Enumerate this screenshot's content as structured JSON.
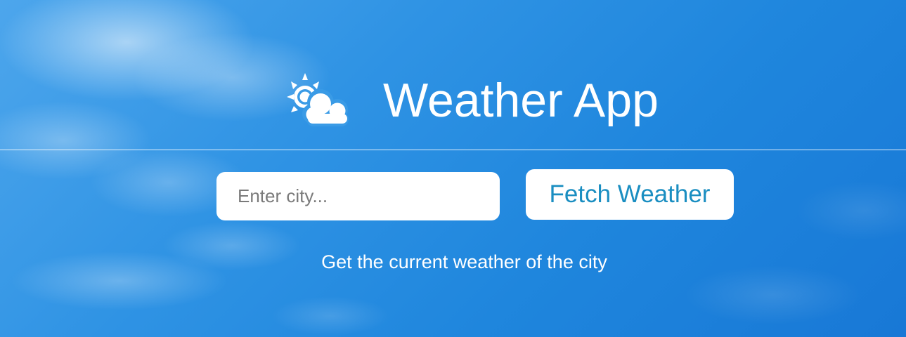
{
  "header": {
    "title": "Weather App",
    "logo_icon": "sun-behind-cloud-icon"
  },
  "search": {
    "placeholder": "Enter city...",
    "value": "",
    "button_label": "Fetch Weather"
  },
  "subtitle": "Get the current weather of the city",
  "colors": {
    "sky_blue": "#2b8ee2",
    "button_text": "#1a8ec1",
    "white": "#ffffff"
  }
}
